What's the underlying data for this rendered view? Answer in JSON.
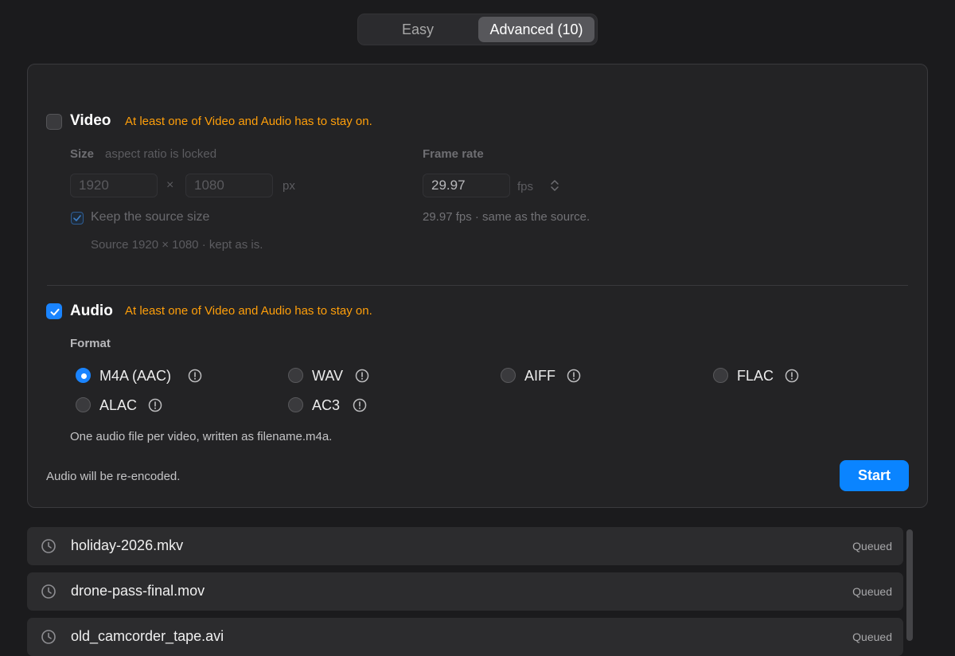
{
  "tabs": {
    "easy": "Easy",
    "advanced": "Advanced (10)"
  },
  "video": {
    "title": "Video",
    "warning": "At least one of Video and Audio has to stay on.",
    "checked": false,
    "size_label": "Size",
    "size_hint": "aspect ratio is locked",
    "width": "1920",
    "times": "×",
    "height": "1080",
    "px": "px",
    "keep_source_label": "Keep the source size",
    "keep_source_checked": true,
    "source_note": "Source 1920 × 1080 · kept as is.",
    "frame_rate_label": "Frame rate",
    "frame_rate": "29.97",
    "fps": "fps",
    "frame_rate_note": "29.97 fps · same as the source."
  },
  "audio": {
    "title": "Audio",
    "warning": "At least one of Video and Audio has to stay on.",
    "checked": true,
    "format_label": "Format",
    "formats": [
      "M4A (AAC)",
      "WAV",
      "AIFF",
      "FLAC",
      "ALAC",
      "AC3"
    ],
    "selected": "M4A (AAC)",
    "format_note": "One audio file per video, written as filename.m4a."
  },
  "footer": {
    "note": "Audio will be re-encoded.",
    "start_label": "Start"
  },
  "colors": {
    "accent": "#0a84ff",
    "warning": "#ff9f0a"
  },
  "queue": [
    {
      "name": "holiday-2026.mkv",
      "status": "Queued"
    },
    {
      "name": "drone-pass-final.mov",
      "status": "Queued"
    },
    {
      "name": "old_camcorder_tape.avi",
      "status": "Queued"
    }
  ]
}
